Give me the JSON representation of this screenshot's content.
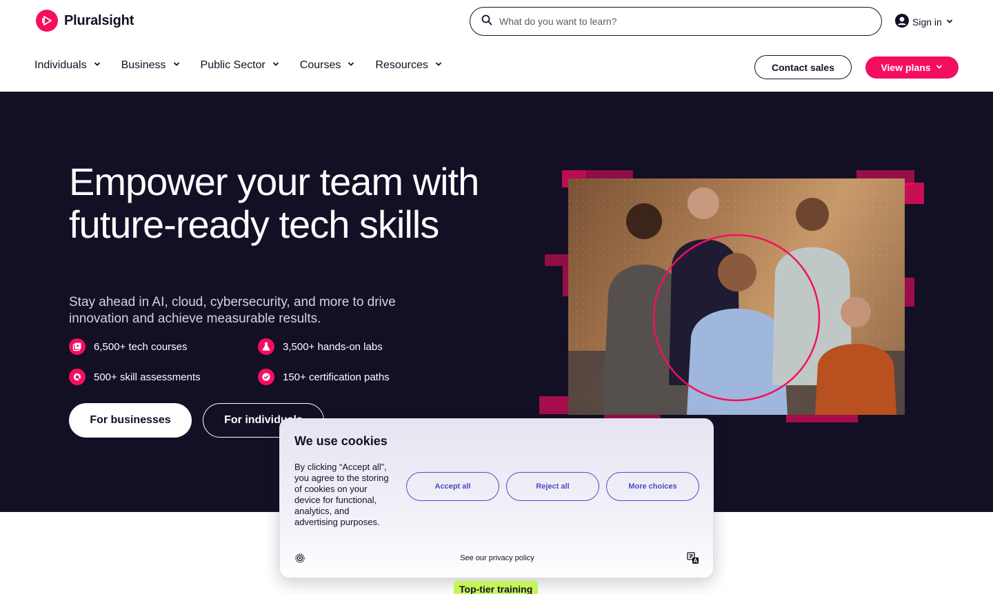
{
  "brand": {
    "name": "Pluralsight",
    "accent": "#f50e60",
    "dark": "#130f25"
  },
  "search": {
    "placeholder": "What do you want to learn?"
  },
  "account": {
    "signin_label": "Sign in"
  },
  "nav": {
    "items": [
      {
        "label": "Individuals"
      },
      {
        "label": "Business"
      },
      {
        "label": "Public Sector"
      },
      {
        "label": "Courses"
      },
      {
        "label": "Resources"
      }
    ]
  },
  "header_actions": {
    "contact_label": "Contact sales",
    "plans_label": "View plans"
  },
  "hero": {
    "title": "Empower your team with future-ready tech skills",
    "subtitle": "Stay ahead in AI, cloud, cybersecurity, and more to drive innovation and achieve measurable results.",
    "features": [
      {
        "label": "6,500+ tech courses",
        "icon": "play-courses-icon"
      },
      {
        "label": "3,500+ hands-on labs",
        "icon": "lab-flask-icon"
      },
      {
        "label": "500+ skill assessments",
        "icon": "assessment-icon"
      },
      {
        "label": "150+ certification paths",
        "icon": "certificate-check-icon"
      }
    ],
    "cta_business": "For businesses",
    "cta_individuals": "For individuals"
  },
  "cookie": {
    "title": "We use cookies",
    "body": "By clicking “Accept all”, you agree to the storing of cookies on your device for functional, analytics, and advertising purposes.",
    "accept_label": "Accept all",
    "reject_label": "Reject all",
    "more_label": "More choices",
    "privacy_label": "See our privacy policy",
    "accent": "#4a4cc4"
  },
  "section_tag": {
    "label": "Top-tier training",
    "color": "#c5f55a"
  }
}
